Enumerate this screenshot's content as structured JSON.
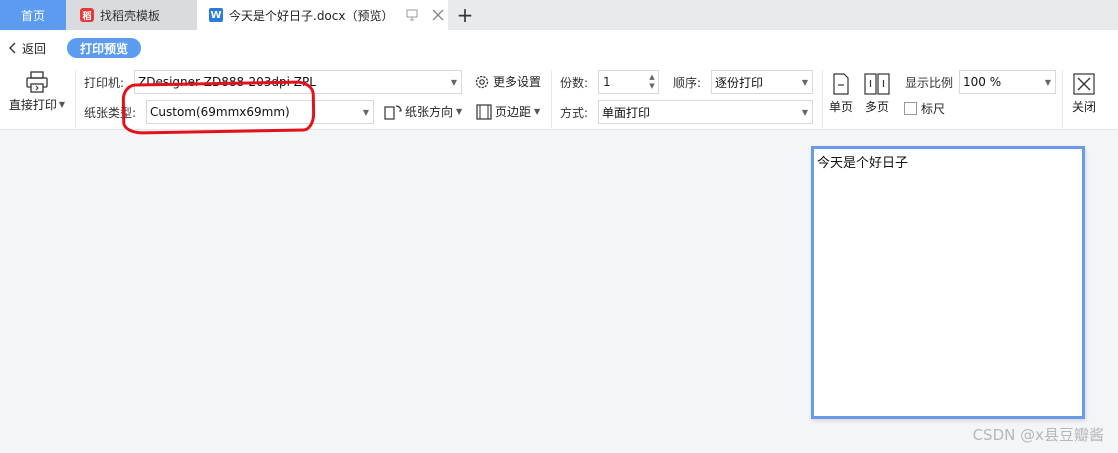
{
  "tabs": {
    "home": "首页",
    "templates": "找稻壳模板",
    "doc": "今天是个好日子.docx（预览）"
  },
  "toolbar": {
    "back": "返回",
    "print_preview": "打印预览",
    "direct_print": "直接打印",
    "printer_label": "打印机:",
    "printer_value": "ZDesigner ZD888-203dpi ZPL",
    "more_settings": "更多设置",
    "paper_type_label": "纸张类型:",
    "paper_type_value": "Custom(69mmx69mm)",
    "paper_orientation": "纸张方向",
    "margins": "页边距",
    "copies_label": "份数:",
    "copies_value": "1",
    "order_label": "顺序:",
    "order_value": "逐份打印",
    "mode_label": "方式:",
    "mode_value": "单面打印",
    "single_page": "单页",
    "multi_page": "多页",
    "zoom_label": "显示比例",
    "zoom_value": "100 %",
    "ruler": "标尺",
    "close": "关闭"
  },
  "preview": {
    "content": "今天是个好日子"
  },
  "watermark": "CSDN @x县豆瓣酱",
  "colors": {
    "accent": "#5b9cf1",
    "page_border": "#6b9ae6",
    "annotation": "#e4111d"
  }
}
